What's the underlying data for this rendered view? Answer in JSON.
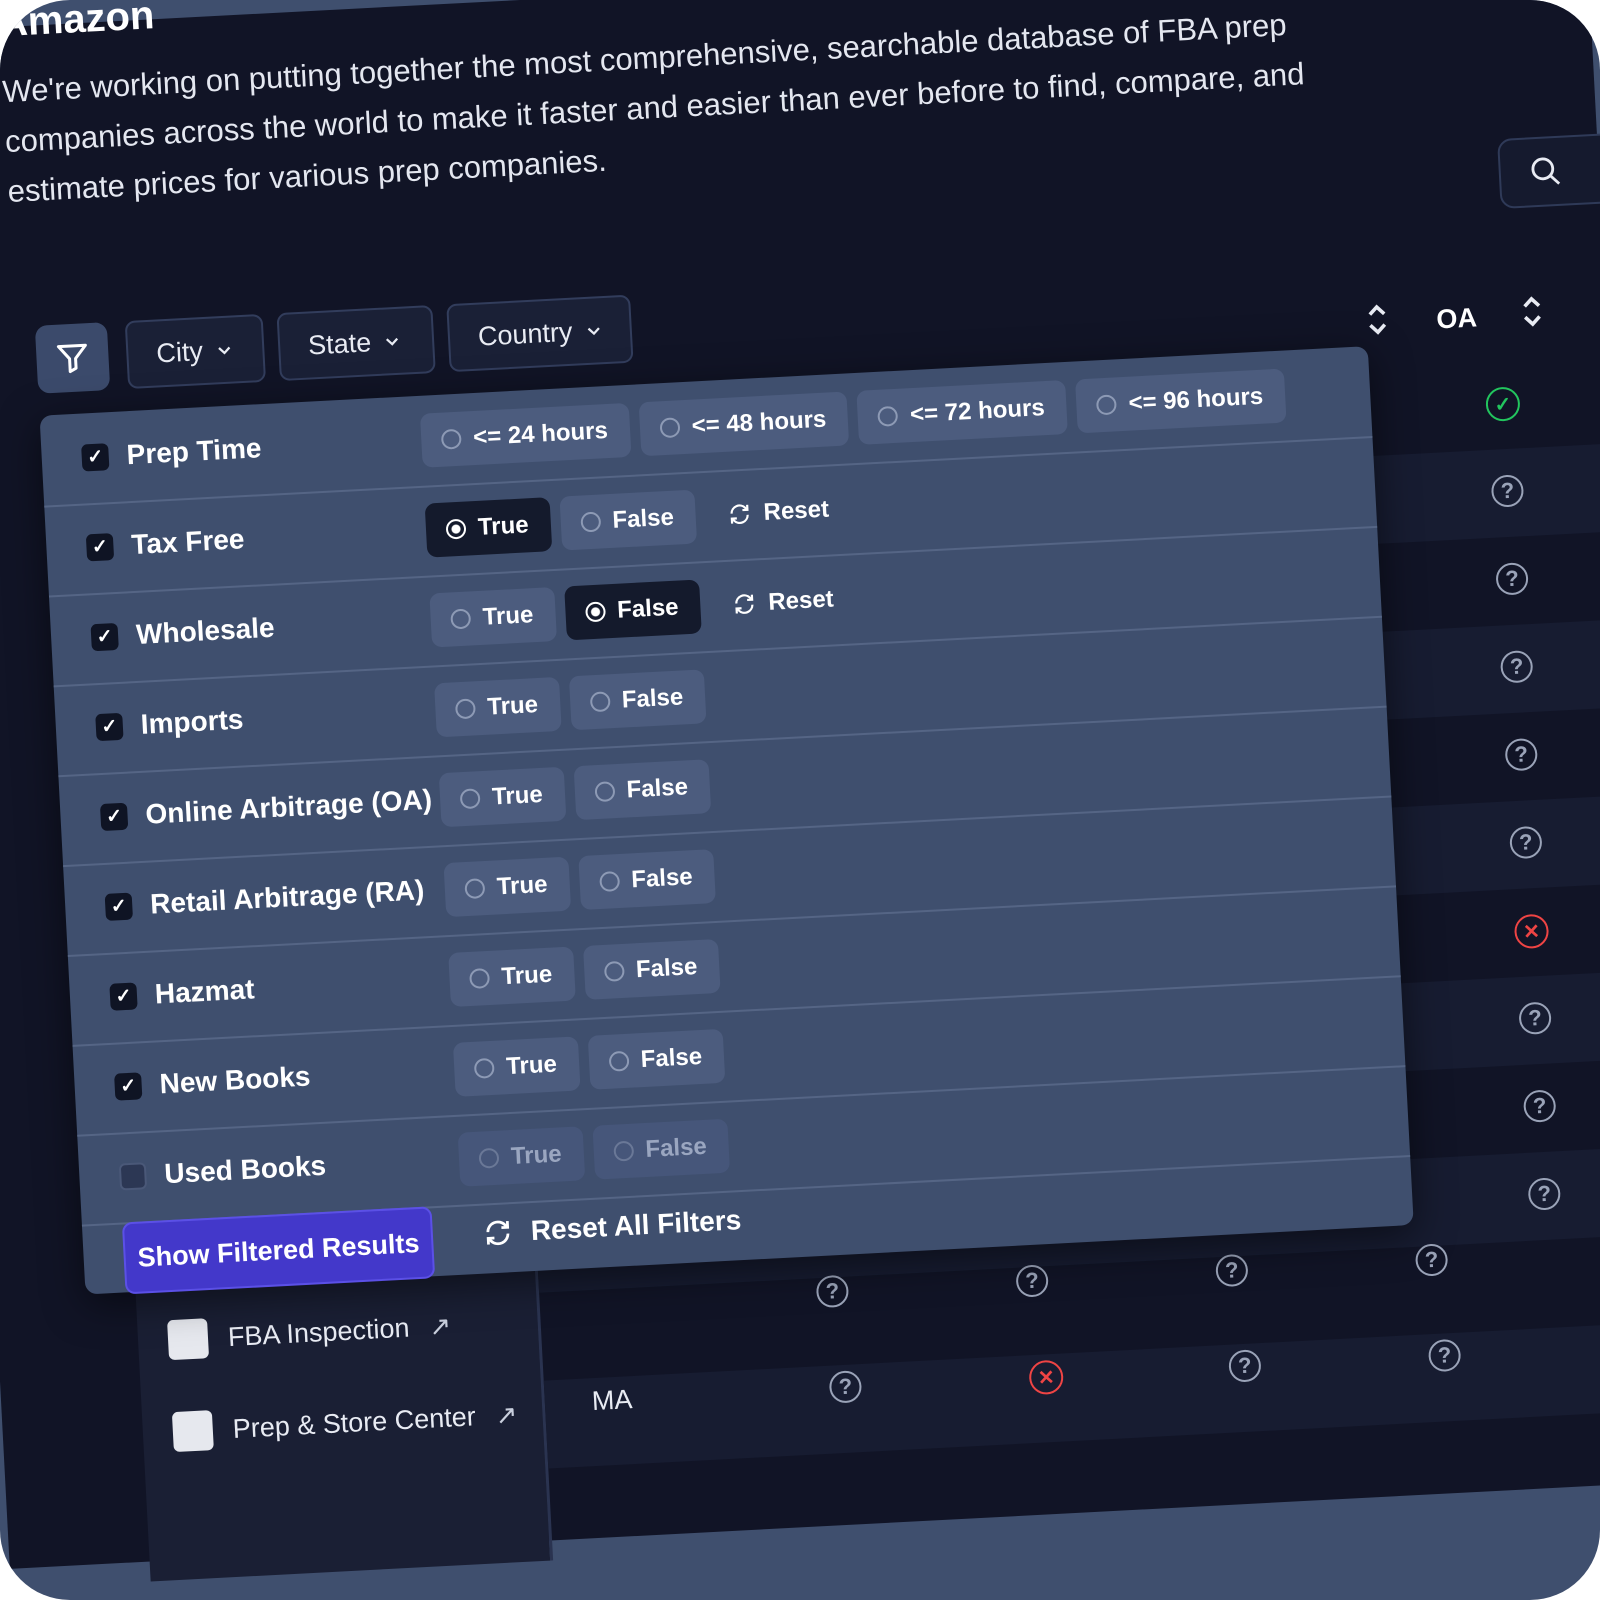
{
  "brand": "Amazon",
  "intro": "We're working on putting together the most comprehensive, searchable database of FBA prep companies across the world to make it faster and easier than ever before to find, compare, and estimate prices for various prep companies.",
  "toolbar": {
    "filter_icon": "filter-icon",
    "dropdowns": [
      {
        "label": "City"
      },
      {
        "label": "State"
      },
      {
        "label": "Country"
      }
    ]
  },
  "table": {
    "visible_header": "OA",
    "companies": [
      "FBA Inspection",
      "Prep & Store Center"
    ],
    "state_value": "MA",
    "oa_column_status": [
      "check",
      "unknown",
      "unknown",
      "unknown",
      "unknown",
      "unknown",
      "cross",
      "unknown",
      "unknown",
      "unknown"
    ]
  },
  "filters": {
    "rows": [
      {
        "label": "Prep Time",
        "checked": true,
        "options": [
          "<= 24 hours",
          "<= 48 hours",
          "<= 72 hours",
          "<= 96 hours"
        ],
        "selected": null,
        "reset": null
      },
      {
        "label": "Tax Free",
        "checked": true,
        "options": [
          "True",
          "False"
        ],
        "selected": "True",
        "reset": "Reset"
      },
      {
        "label": "Wholesale",
        "checked": true,
        "options": [
          "True",
          "False"
        ],
        "selected": "False",
        "reset": "Reset"
      },
      {
        "label": "Imports",
        "checked": true,
        "options": [
          "True",
          "False"
        ],
        "selected": null,
        "reset": null
      },
      {
        "label": "Online Arbitrage (OA)",
        "checked": true,
        "options": [
          "True",
          "False"
        ],
        "selected": null,
        "reset": null
      },
      {
        "label": "Retail Arbitrage (RA)",
        "checked": true,
        "options": [
          "True",
          "False"
        ],
        "selected": null,
        "reset": null
      },
      {
        "label": "Hazmat",
        "checked": true,
        "options": [
          "True",
          "False"
        ],
        "selected": null,
        "reset": null
      },
      {
        "label": "New Books",
        "checked": true,
        "options": [
          "True",
          "False"
        ],
        "selected": null,
        "reset": null
      },
      {
        "label": "Used Books",
        "checked": false,
        "options": [
          "True",
          "False"
        ],
        "selected": null,
        "reset": null
      }
    ],
    "show_button": "Show Filtered Results",
    "reset_all": "Reset All Filters"
  },
  "colors": {
    "background": "#111426",
    "panel": "#3f4f6e",
    "primary_button": "#4338ca",
    "success": "#22c55e",
    "danger": "#ef4444"
  }
}
